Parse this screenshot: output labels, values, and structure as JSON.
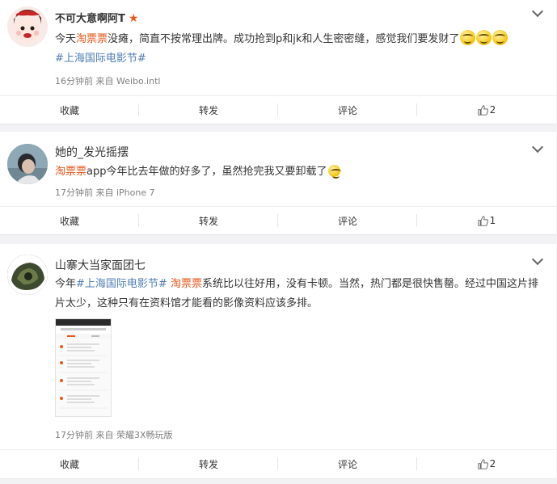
{
  "posts": [
    {
      "username": "不可大意啊阿T",
      "text_parts": [
        "今天",
        "淘票票",
        "没瘫，简直不按常理出牌。成功抢到p和jk和人生密密缝，感觉我们要发财了"
      ],
      "hashtag": "#上海国际电影节#",
      "meta": "16分钟前 来自 Weibo.intl",
      "actions": {
        "collect": "收藏",
        "forward": "转发",
        "comment": "评论",
        "likes": "2"
      },
      "emoji": "grin-emoji"
    },
    {
      "username": "她的_发光摇摆",
      "text_parts": [
        "淘票票",
        "app今年比去年做的好多了，虽然抢完我又要卸载了"
      ],
      "meta": "17分钟前 来自 iPhone 7",
      "actions": {
        "collect": "收藏",
        "forward": "转发",
        "comment": "评论",
        "likes": "1"
      }
    },
    {
      "username": "山寨大当家面团七",
      "text_parts": [
        "今年",
        "#上海国际电影节#",
        " ",
        "淘票票",
        "系统比以往好用，没有卡顿。当然，热门都是很快售罄。经过中国这片排片太少，这种只有在资料馆才能看的影像资料应该多排。"
      ],
      "meta": "17分钟前 来自 荣耀3X畅玩版",
      "actions": {
        "collect": "收藏",
        "forward": "转发",
        "comment": "评论",
        "likes": "2"
      }
    }
  ],
  "colors": {
    "brand": "#e8571b",
    "link": "#4f7db5",
    "muted": "#808080"
  }
}
